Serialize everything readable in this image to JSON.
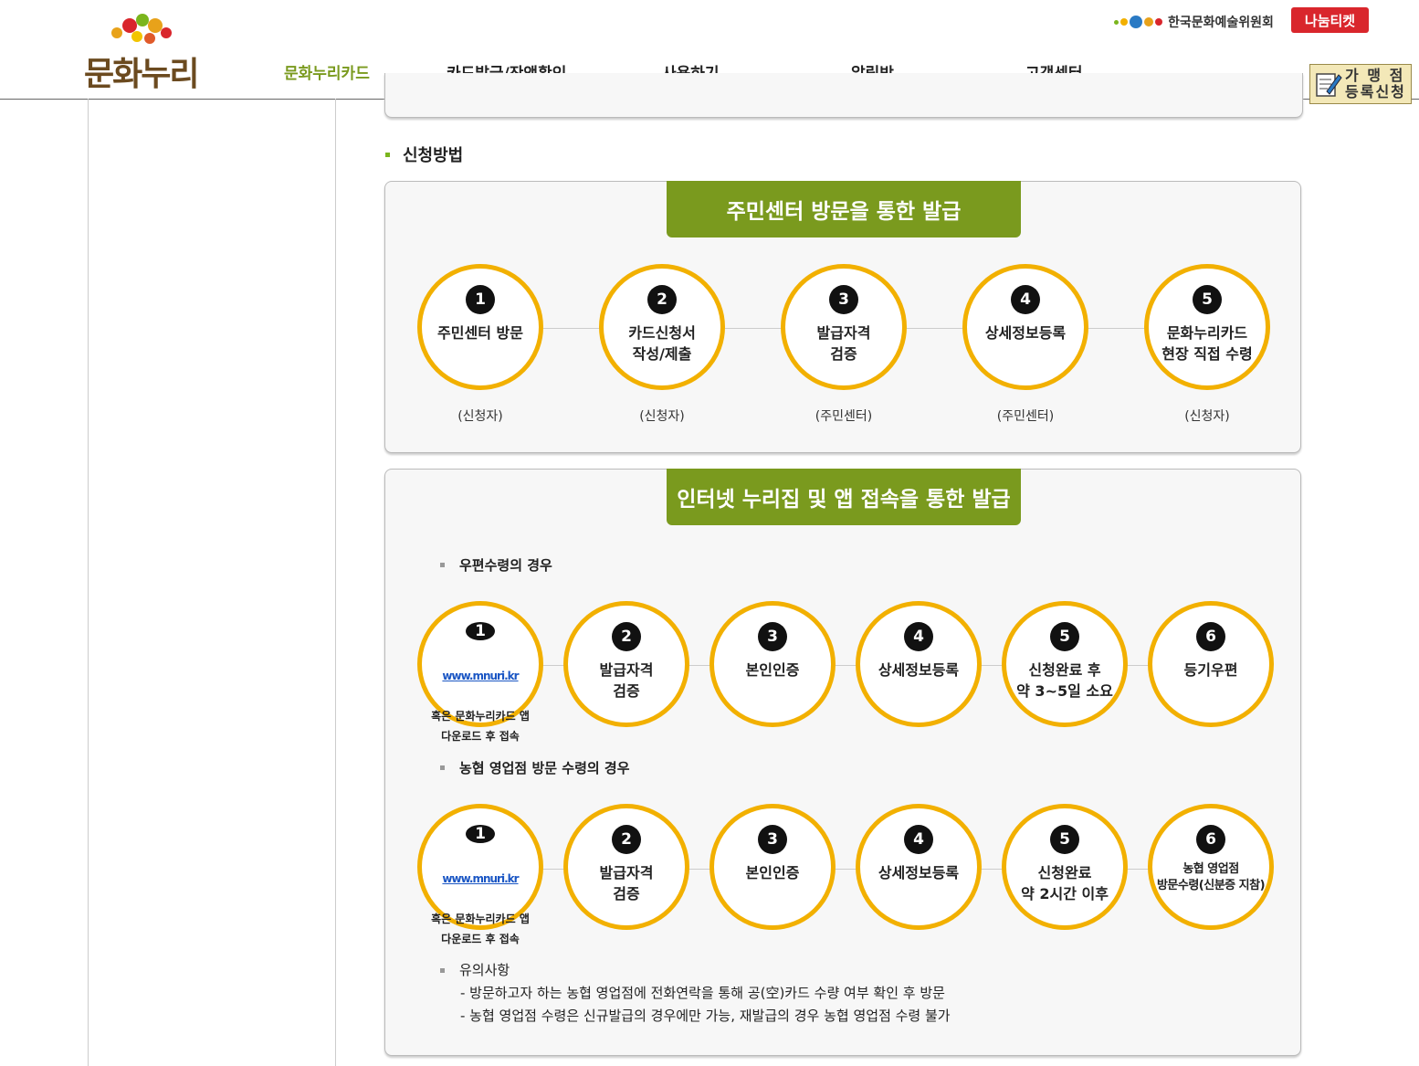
{
  "header": {
    "logo_text": "문화누리",
    "org_name": "한국문화예술위원회",
    "ticket_label": "나눔티켓",
    "nav": [
      "문화누리카드",
      "카드발급/잔액확인",
      "사용하기",
      "알림방",
      "고객센터"
    ],
    "franchise": {
      "line1": "가 맹 점",
      "line2": "등록신청"
    }
  },
  "section_title": "신청방법",
  "box1": {
    "banner": "주민센터 방문을 통한 발급",
    "steps": [
      {
        "num": "1",
        "text": "주민센터 방문",
        "role": "(신청자)"
      },
      {
        "num": "2",
        "text": "카드신청서\n작성/제출",
        "role": "(신청자)"
      },
      {
        "num": "3",
        "text": "발급자격\n검증",
        "role": "(주민센터)"
      },
      {
        "num": "4",
        "text": "상세정보등록",
        "role": "(주민센터)"
      },
      {
        "num": "5",
        "text": "문화누리카드\n현장 직접 수령",
        "role": "(신청자)"
      }
    ]
  },
  "box2": {
    "banner": "인터넷 누리집 및 앱 접속을 통한 발급",
    "mail": {
      "label": "우편수령의 경우",
      "steps": [
        {
          "num": "1",
          "link": "www.mnuri.kr",
          "text": "혹은 문화누리카드 앱\n다운로드 후 접속"
        },
        {
          "num": "2",
          "text": "발급자격\n검증"
        },
        {
          "num": "3",
          "text": "본인인증"
        },
        {
          "num": "4",
          "text": "상세정보등록"
        },
        {
          "num": "5",
          "text": "신청완료 후\n약 3~5일 소요"
        },
        {
          "num": "6",
          "text": "등기우편"
        }
      ]
    },
    "branch": {
      "label": "농협 영업점 방문 수령의 경우",
      "steps": [
        {
          "num": "1",
          "link": "www.mnuri.kr",
          "text": "혹은 문화누리카드 앱\n다운로드 후 접속"
        },
        {
          "num": "2",
          "text": "발급자격\n검증"
        },
        {
          "num": "3",
          "text": "본인인증"
        },
        {
          "num": "4",
          "text": "상세정보등록"
        },
        {
          "num": "5",
          "text": "신청완료\n약 2시간 이후"
        },
        {
          "num": "6",
          "text": "농협 영업점\n방문수령(신분증 지참)"
        }
      ]
    },
    "notes": {
      "head": "유의사항",
      "items": [
        "- 방문하고자 하는 농협 영업점에 전화연락을 통해 공(空)카드 수량 여부 확인 후 방문",
        "- 농협 영업점 수령은 신규발급의 경우에만 가능, 재발급의 경우 농협 영업점 수령 불가"
      ]
    }
  }
}
